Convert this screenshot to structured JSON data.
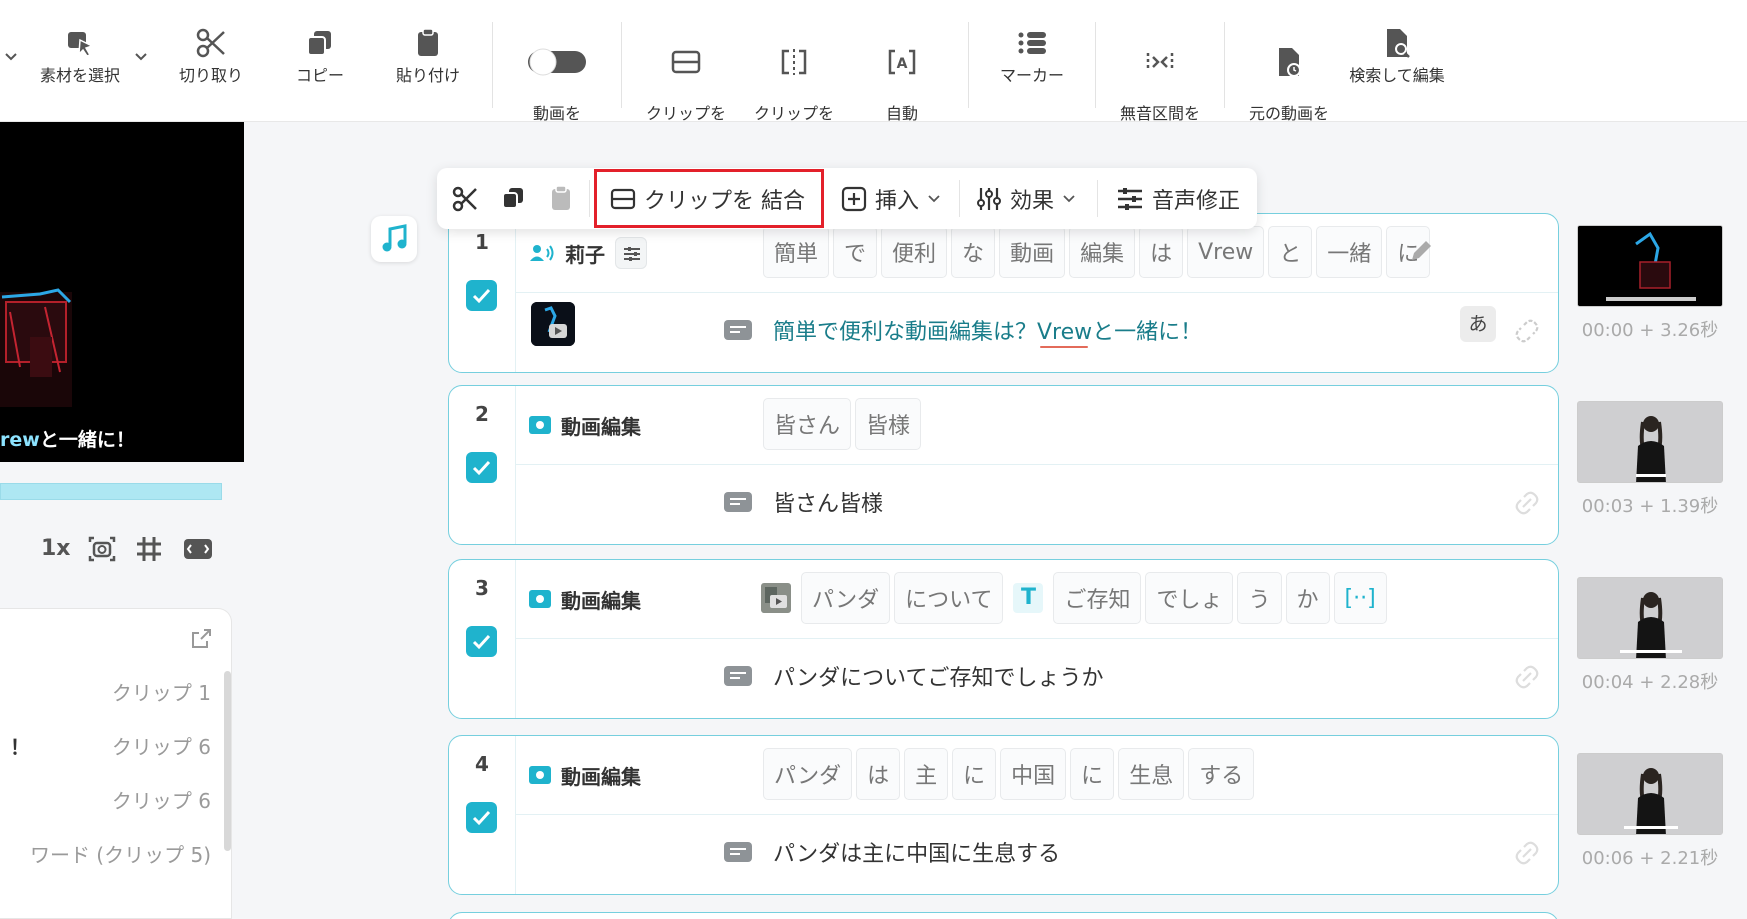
{
  "toolbar": {
    "items": [
      {
        "label": "素材を選択",
        "icon": "select-cursor-icon"
      },
      {
        "label": "切り取り",
        "icon": "scissors-icon"
      },
      {
        "label": "コピー",
        "icon": "copy-icon"
      },
      {
        "label": "貼り付け",
        "icon": "paste-icon"
      },
      {
        "label": "動画を\nロックする",
        "icon": "toggle-icon"
      },
      {
        "label": "クリップを\n結合",
        "icon": "merge-clip-icon"
      },
      {
        "label": "クリップを\n分割",
        "icon": "split-clip-icon"
      },
      {
        "label": "自動\nクリップ分割",
        "icon": "auto-split-icon"
      },
      {
        "label": "マーカー",
        "icon": "marker-list-icon"
      },
      {
        "label": "無音区間を\n短縮",
        "icon": "silence-shorten-icon"
      },
      {
        "label": "元の動画を\n確認",
        "icon": "original-video-icon"
      },
      {
        "label": "検索して編集",
        "icon": "search-edit-icon"
      }
    ]
  },
  "preview": {
    "caption_highlight": "rew",
    "caption_rest": "と一緒に！"
  },
  "controls": {
    "speed": "1x"
  },
  "clip_list": {
    "items": [
      "クリップ 1",
      "クリップ 6",
      "クリップ 6",
      "ワード (クリップ 5)"
    ],
    "partial_text": "！"
  },
  "float_bar": {
    "merge_label": "クリップを 結合",
    "insert_label": "挿入",
    "effect_label": "効果",
    "voice_label": "音声修正"
  },
  "clips": [
    {
      "number": "1",
      "speaker": "莉子",
      "words": [
        "簡単",
        "で",
        "便利",
        "な",
        "動画",
        "編集",
        "は",
        "Vrew",
        "と",
        "一緒",
        "に"
      ],
      "subtitle": "簡単で便利な動画編集は？Vrewと一緒に！",
      "kana": "あ",
      "time": "00:00 + 3.26秒"
    },
    {
      "number": "2",
      "speaker": "動画編集",
      "words": [
        "皆さん",
        "皆様"
      ],
      "subtitle": "皆さん皆様",
      "time": "00:03 + 1.39秒"
    },
    {
      "number": "3",
      "speaker": "動画編集",
      "words": [
        "パンダ",
        "について",
        "T",
        "ご存知",
        "でしょ",
        "う",
        "か",
        "[··]"
      ],
      "subtitle": "パンダについてご存知でしょうか",
      "time": "00:04 + 2.28秒"
    },
    {
      "number": "4",
      "speaker": "動画編集",
      "words": [
        "パンダ",
        "は",
        "主",
        "に",
        "中国",
        "に",
        "生息",
        "する"
      ],
      "subtitle": "パンダは主に中国に生息する",
      "time": "00:06 + 2.21秒"
    }
  ],
  "colors": {
    "accent": "#1fb3cd",
    "highlight_box": "#e3202a",
    "card_border": "#76cfde"
  }
}
